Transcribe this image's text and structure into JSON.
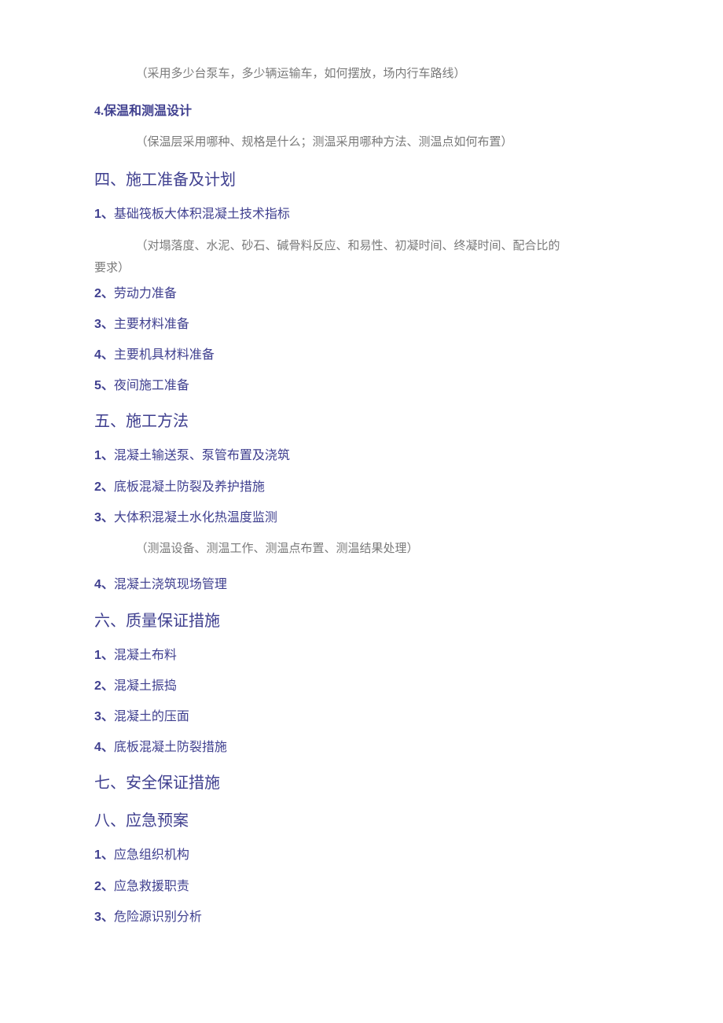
{
  "top_note": "（采用多少台泵车，多少辆运输车，如何摆放，场内行车路线）",
  "sub4": {
    "num": "4.",
    "title": "保温和测温设计"
  },
  "sub4_note": "（保温层采用哪种、规格是什么；测温采用哪种方法、测温点如何布置）",
  "sec4": {
    "title": "四、施工准备及计划",
    "item1": {
      "num": "1、",
      "txt": "基础筏板大体积混凝土技术指标"
    },
    "item1_note_l1": "（对塌落度、水泥、砂石、碱骨料反应、和易性、初凝时间、终凝时间、配合比的",
    "item1_note_l2": "要求）",
    "item2": {
      "num": "2、",
      "txt": "劳动力准备"
    },
    "item3": {
      "num": "3、",
      "txt": "主要材料准备"
    },
    "item4": {
      "num": "4、",
      "txt": "主要机具材料准备"
    },
    "item5": {
      "num": "5、",
      "txt": "夜间施工准备"
    }
  },
  "sec5": {
    "title": "五、施工方法",
    "item1": {
      "num": "1、",
      "txt": "混凝土输送泵、泵管布置及浇筑"
    },
    "item2": {
      "num": "2、",
      "txt": "底板混凝土防裂及养护措施"
    },
    "item3": {
      "num": "3、",
      "txt": "大体积混凝土水化热温度监测"
    },
    "item3_note": "（测温设备、测温工作、测温点布置、测温结果处理）",
    "item4": {
      "num": "4、",
      "txt": "混凝土浇筑现场管理"
    }
  },
  "sec6": {
    "title": "六、质量保证措施",
    "item1": {
      "num": "1、",
      "txt": "混凝土布料"
    },
    "item2": {
      "num": "2、",
      "txt": "混凝土振捣"
    },
    "item3": {
      "num": "3、",
      "txt": "混凝土的压面"
    },
    "item4": {
      "num": "4、",
      "txt": "底板混凝土防裂措施"
    }
  },
  "sec7": {
    "title": "七、安全保证措施"
  },
  "sec8": {
    "title": "八、应急预案",
    "item1": {
      "num": "1、",
      "txt": "应急组织机构"
    },
    "item2": {
      "num": "2、",
      "txt": "应急救援职责"
    },
    "item3": {
      "num": "3、",
      "txt": "危险源识别分析"
    }
  }
}
